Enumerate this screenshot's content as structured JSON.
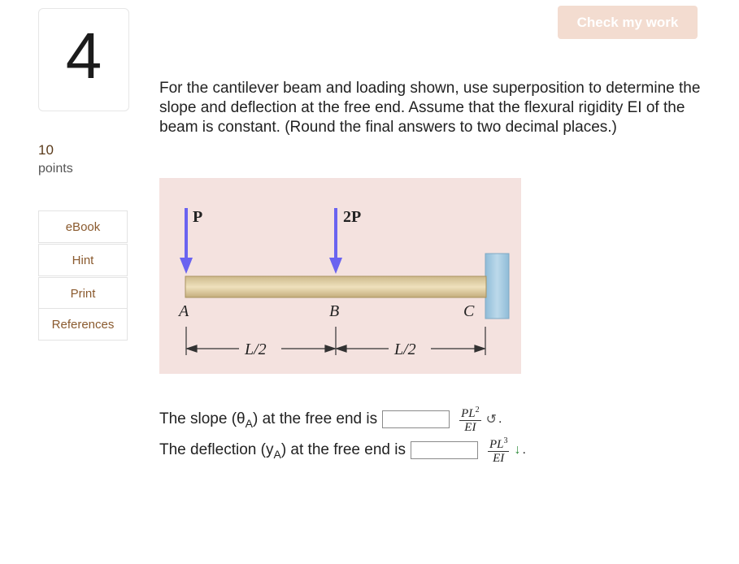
{
  "question": {
    "number": "4",
    "points_value": "10",
    "points_label": "points"
  },
  "sidebar": {
    "buttons": [
      {
        "label": "eBook"
      },
      {
        "label": "Hint"
      },
      {
        "label": "Print"
      },
      {
        "label": "References"
      }
    ]
  },
  "header": {
    "check_label": "Check my work"
  },
  "prompt": "For the cantilever beam and loading shown, use superposition to determine the slope and deflection at the free end. Assume that the flexural rigidity EI of the beam is constant. (Round the final answers to two decimal places.)",
  "figure": {
    "load_p": "P",
    "load_2p": "2P",
    "point_a": "A",
    "point_b": "B",
    "point_c": "C",
    "dim_left": "L/2",
    "dim_right": "L/2",
    "colors": {
      "background": "#f4e2df",
      "arrow": "#6a63f0",
      "beam": "#e6d3a8",
      "wall": "#9fc6df"
    }
  },
  "answers": {
    "slope": {
      "prefix": "The slope (θ",
      "sub": "A",
      "suffix": ") at the free end is",
      "value": "",
      "unit_num_base": "PL",
      "unit_num_exp": "2",
      "unit_den": "EI",
      "direction_icon": "counterclockwise-rotation-icon",
      "direction_glyph": "↺",
      "direction_color": "#555555",
      "end": "."
    },
    "deflection": {
      "prefix": "The deflection (y",
      "sub": "A",
      "suffix": ") at the free end is",
      "value": "",
      "unit_num_base": "PL",
      "unit_num_exp": "3",
      "unit_den": "EI",
      "direction_icon": "down-arrow-icon",
      "direction_glyph": "↓",
      "direction_color": "#2e8b3a",
      "end": "."
    }
  }
}
